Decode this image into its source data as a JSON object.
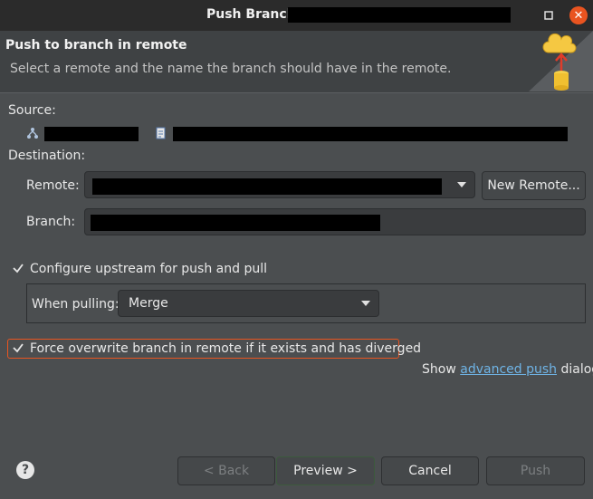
{
  "window": {
    "title": "Push Branch"
  },
  "banner": {
    "title": "Push to branch in remote",
    "subtitle": "Select a remote and the name the branch should have in the remote.",
    "icon": "push-branch-wizard-icon"
  },
  "source": {
    "label": "Source:",
    "repo_icon": "git-repository-icon",
    "branch_icon": "git-branch-icon"
  },
  "destination": {
    "label": "Destination:",
    "remote_label": "Remote:",
    "branch_label": "Branch:",
    "new_remote_button": "New Remote..."
  },
  "upstream": {
    "configure_label": "Configure upstream for push and pull",
    "configure_checked": true,
    "when_pulling_label": "When pulling:",
    "when_pulling_value": "Merge"
  },
  "force": {
    "label": "Force overwrite branch in remote if it exists and has diverged",
    "checked": true
  },
  "advanced": {
    "prefix": "Show ",
    "link": "advanced push",
    "suffix": " dialog"
  },
  "buttons": {
    "back": "< Back",
    "preview": "Preview >",
    "cancel": "Cancel",
    "push": "Push"
  }
}
